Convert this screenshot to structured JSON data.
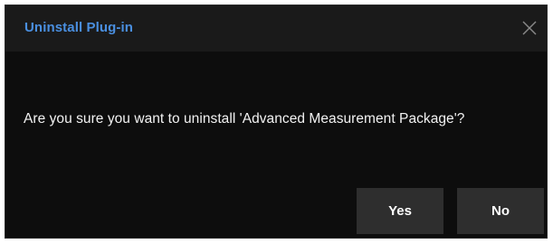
{
  "dialog": {
    "title": "Uninstall Plug-in",
    "close_icon": "close-icon",
    "message": "Are you sure you want to uninstall 'Advanced Measurement Package'?",
    "buttons": {
      "yes_label": "Yes",
      "no_label": "No"
    }
  },
  "colors": {
    "title": "#4a8fe0",
    "background": "#0d0d0d",
    "titlebar": "#1a1a1a",
    "button": "#2e2e2e",
    "text": "#f2f2f2"
  }
}
